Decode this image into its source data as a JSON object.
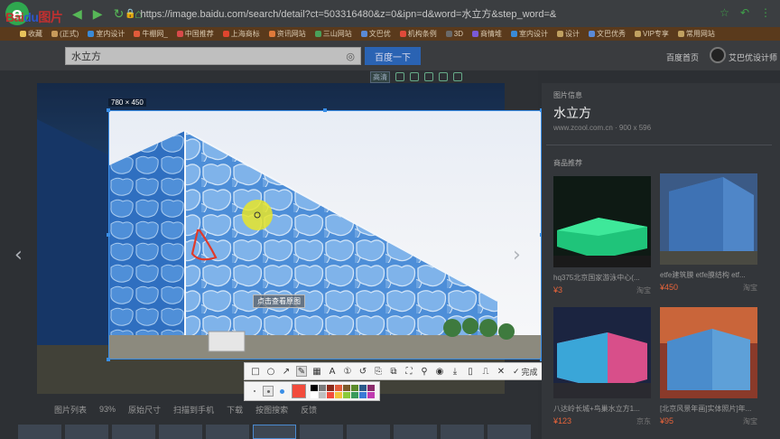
{
  "browser": {
    "logo": "e",
    "secure_label": "https",
    "url": "https://image.baidu.com/search/detail?ct=503316480&z=0&ipn=d&word=水立方&step_word=&"
  },
  "bookmarks": [
    {
      "label": "收藏",
      "color": "#e8c35a"
    },
    {
      "label": "(正式)",
      "color": "#c89a5a"
    },
    {
      "label": "室内设计",
      "color": "#3a8ad6"
    },
    {
      "label": "牛棚网_",
      "color": "#e25b3a"
    },
    {
      "label": "中国推荐",
      "color": "#d84a4a"
    },
    {
      "label": "上海商标",
      "color": "#e0452e"
    },
    {
      "label": "资讯网站",
      "color": "#e07a3a"
    },
    {
      "label": "三山网站",
      "color": "#4aa05a"
    },
    {
      "label": "文巴优",
      "color": "#5a8ad6"
    },
    {
      "label": "机构条例",
      "color": "#e04a3a"
    },
    {
      "label": "3D",
      "color": "#6a6a6a"
    },
    {
      "label": "商情堆",
      "color": "#7a5ad6"
    },
    {
      "label": "室内设计",
      "color": "#3a8ad6"
    },
    {
      "label": "设计",
      "color": "#c0a060"
    },
    {
      "label": "文巴优秀",
      "color": "#5a8ad6"
    },
    {
      "label": "VIP专享",
      "color": "#c0a060"
    },
    {
      "label": "常用网站",
      "color": "#c0a060"
    }
  ],
  "header": {
    "logo_text": "Bai",
    "logo_paw": "du",
    "logo_suffix": "图片",
    "search_value": "水立方",
    "search_button": "百度一下",
    "home_link": "百度首页",
    "user_name": "艾巴优设计师"
  },
  "viewer": {
    "hq_label": "高清",
    "selection_size": "780 × 450",
    "tooltip": "点击查看原图",
    "prev": "‹",
    "next": "›"
  },
  "annotation_toolbar": {
    "done_label": "完成"
  },
  "palette": {
    "current_color": "#f24b3c",
    "swatches": [
      "#000000",
      "#7a7a7a",
      "#8a2a1a",
      "#e25b3a",
      "#7a5a2a",
      "#5a8a2a",
      "#2a5a8a",
      "#8a2a6a",
      "#ffffff",
      "#c0c0c0",
      "#f24b3c",
      "#f2c23a",
      "#8aca3a",
      "#3a9a5a",
      "#3a7ad6",
      "#c03ab0"
    ]
  },
  "bottom_bar": {
    "list": "图片列表",
    "zoom": "93%",
    "original_size": "原始尺寸",
    "scan_phone": "扫描到手机",
    "download": "下载",
    "image_search": "按图搜索",
    "feedback": "反馈"
  },
  "right_panel": {
    "info_label": "图片信息",
    "title": "水立方",
    "source": "www.zcool.com.cn",
    "dims": "900 x 596",
    "section_label": "商品推荐",
    "products": [
      {
        "title": "hq375北京国家游泳中心(...",
        "price": "¥3",
        "store": "淘宝"
      },
      {
        "title": "etfe建筑膜 etfe膜结构 etf...",
        "price": "¥450",
        "store": "淘宝"
      },
      {
        "title": "八达岭长城+鸟巢水立方1...",
        "price": "¥123",
        "store": "京东"
      },
      {
        "title": "[北京风景年画]实体照片]年...",
        "price": "¥95",
        "store": "淘宝"
      }
    ]
  }
}
